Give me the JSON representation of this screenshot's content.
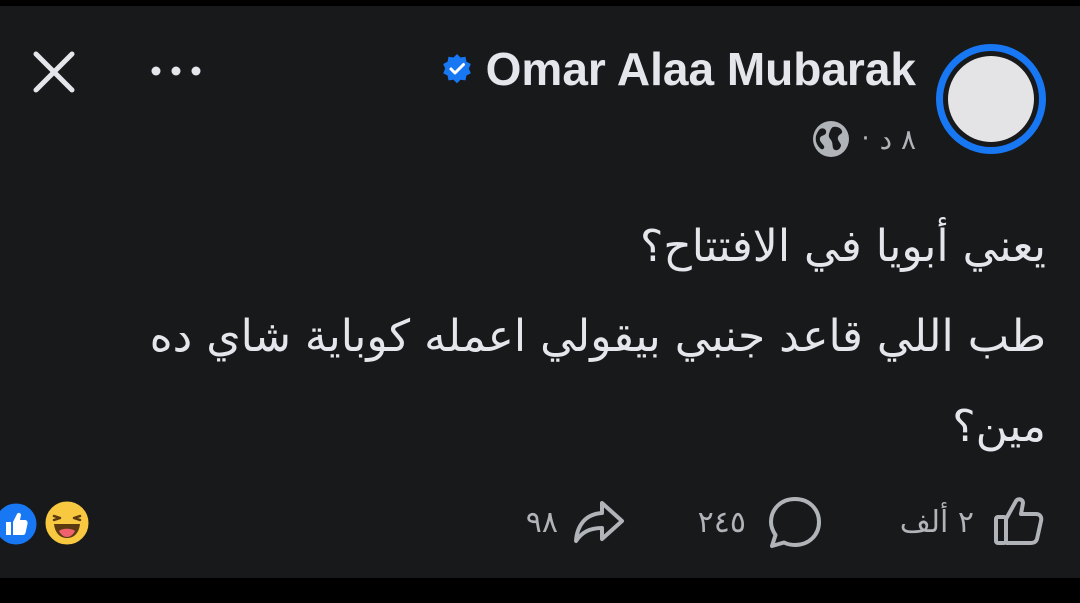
{
  "header": {
    "author_name": "Omar Alaa Mubarak",
    "meta_time": "٨ د",
    "meta_separator": "·",
    "icons": {
      "close": "close-icon",
      "more": "more-horizontal-icon",
      "verified": "verified-badge-icon",
      "privacy": "globe-icon"
    }
  },
  "post": {
    "lines": [
      "يعني أبويا في الافتتاح؟",
      "طب اللي قاعد جنبي بيقولي اعمله كوباية شاي ده",
      "مين؟"
    ]
  },
  "footer": {
    "reactions": [
      "like-reaction-icon",
      "haha-reaction-icon"
    ],
    "likes_count": "٢ ألف",
    "comments_count": "٢٤٥",
    "shares_count": "٩٨"
  },
  "colors": {
    "background": "#18191b",
    "text": "#e4e6eb",
    "secondary_text": "#b0b3b8",
    "accent": "#1877f2",
    "haha_yellow": "#f7c840"
  }
}
